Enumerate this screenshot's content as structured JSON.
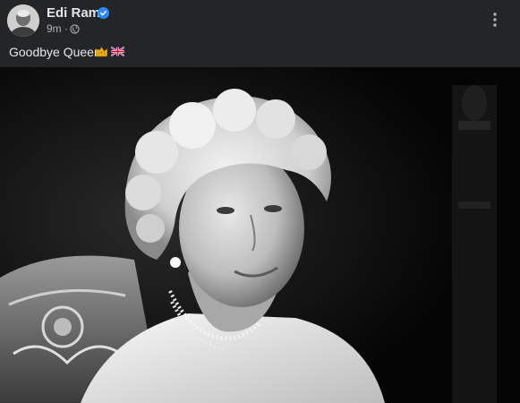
{
  "post": {
    "author_name": "Edi Rama",
    "time": "9m",
    "separator": "·",
    "text": "Goodbye Queen",
    "icons": {
      "verified": "verified-badge-icon",
      "audience": "globe-icon",
      "more": "more-options-icon",
      "emoji_1": "crown-emoji",
      "emoji_2": "uk-flag-emoji"
    }
  },
  "colors": {
    "background": "#242526",
    "primary_text": "#e4e6eb",
    "secondary_text": "#b0b3b8",
    "verified_blue": "#2d88ff"
  }
}
